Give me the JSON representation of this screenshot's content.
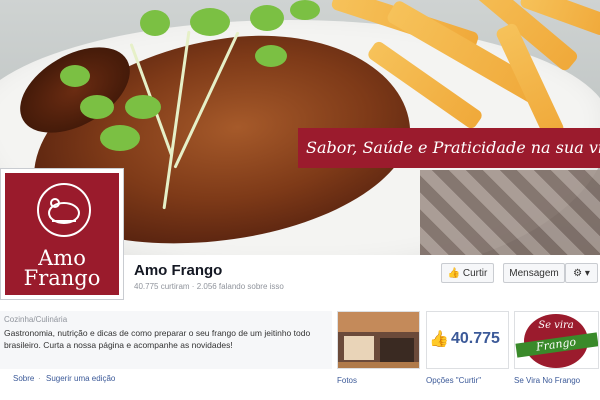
{
  "cover": {
    "slogan": "Sabor, Saúde e Praticidade na sua vida"
  },
  "profile": {
    "logo_line1": "Amo",
    "logo_line2": "Frango"
  },
  "page": {
    "name": "Amo Frango",
    "stats": "40.775 curtiram · 2.056 falando sobre isso"
  },
  "actions": {
    "like_label": "Curtir",
    "message_label": "Mensagem",
    "gear_label": "⚙ ▾"
  },
  "about": {
    "category": "Cozinha/Culinária",
    "description": "Gastronomia, nutrição e dicas de como preparar o seu frango de um jeitinho todo brasileiro. Curta a nossa página e acompanhe as novidades!",
    "link_about": "Sobre",
    "link_separator": "·",
    "link_suggest": "Sugerir uma edição"
  },
  "tiles": {
    "photos_label": "Fotos",
    "likes_count": "40.775",
    "likes_label": "Opções \"Curtir\"",
    "app_label": "Se Vira No Frango",
    "app_badge_line1": "Se vira",
    "app_badge_line2": "Frango"
  },
  "colors": {
    "brand_red": "#9b1b2d",
    "facebook_blue": "#3b5998"
  }
}
